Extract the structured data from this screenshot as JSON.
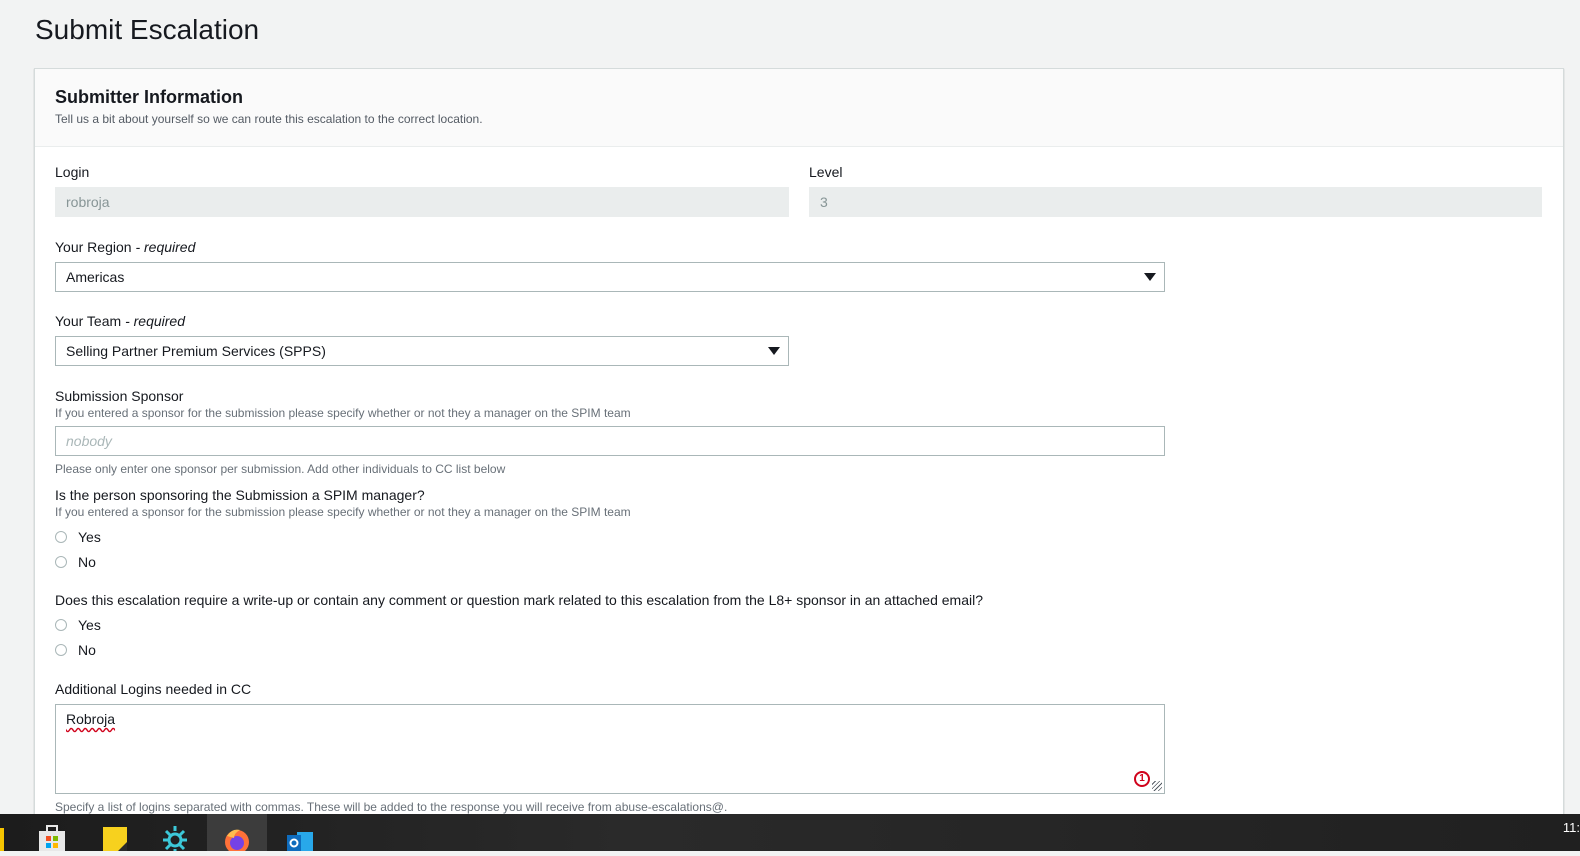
{
  "page": {
    "title": "Submit Escalation"
  },
  "section": {
    "title": "Submitter Information",
    "description": "Tell us a bit about yourself so we can route this escalation to the correct location."
  },
  "login": {
    "label": "Login",
    "value": "robroja"
  },
  "level": {
    "label": "Level",
    "value": "3"
  },
  "region": {
    "label": "Your Region",
    "required": "- required",
    "value": "Americas"
  },
  "team": {
    "label": "Your Team",
    "required": "- required",
    "value": "Selling Partner Premium Services (SPPS)"
  },
  "sponsor": {
    "label": "Submission Sponsor",
    "description": "If you entered a sponsor for the submission please specify whether or not they a manager on the SPIM team",
    "placeholder": "nobody",
    "hint": "Please only enter one sponsor per submission. Add other individuals to CC list below"
  },
  "spim_manager": {
    "question": "Is the person sponsoring the Submission a SPIM manager?",
    "description": "If you entered a sponsor for the submission please specify whether or not they a manager on the SPIM team",
    "options": [
      "Yes",
      "No"
    ]
  },
  "writeup": {
    "question": "Does this escalation require a write-up or contain any comment or question mark related to this escalation from the L8+ sponsor in an attached email?",
    "options": [
      "Yes",
      "No"
    ]
  },
  "cc": {
    "label": "Additional Logins needed in CC",
    "value": "Robroja",
    "grammar_count": "1",
    "hint": "Specify a list of logins separated with commas. These will be added to the response you will receive from abuse-escalations@."
  },
  "taskbar": {
    "clock": "11:"
  },
  "colors": {
    "error": "#d0021b",
    "border": "#aab7b8",
    "readonly_bg": "#eaeded"
  }
}
